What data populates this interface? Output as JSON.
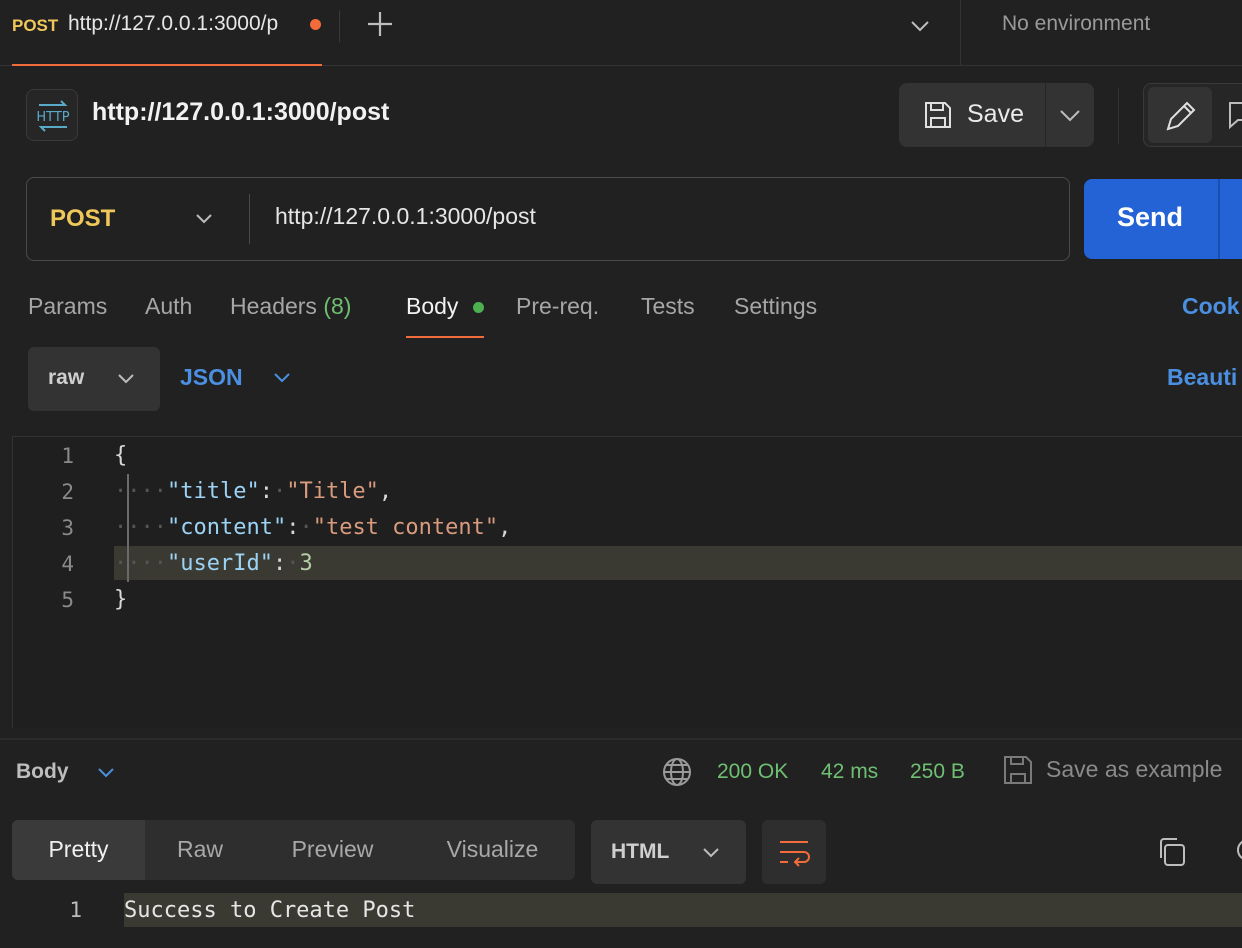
{
  "tabbar": {
    "active_tab": {
      "method": "POST",
      "title": "http://127.0.0.1:3000/p"
    },
    "environment": "No environment"
  },
  "request": {
    "name": "http://127.0.0.1:3000/post",
    "save_label": "Save",
    "method": "POST",
    "url": "http://127.0.0.1:3000/post",
    "send_label": "Send"
  },
  "request_tabs": {
    "params": "Params",
    "auth": "Auth",
    "headers": "Headers",
    "headers_count": "(8)",
    "body": "Body",
    "prereq": "Pre-req.",
    "tests": "Tests",
    "settings": "Settings",
    "cookies": "Cook"
  },
  "body_options": {
    "mode": "raw",
    "language": "JSON",
    "beautify": "Beauti"
  },
  "editor": {
    "lines": [
      {
        "num": "1",
        "text": "{"
      },
      {
        "num": "2",
        "key": "\"title\"",
        "value": "\"Title\""
      },
      {
        "num": "3",
        "key": "\"content\"",
        "value": "\"test content\""
      },
      {
        "num": "4",
        "key": "\"userId\"",
        "value": "3"
      },
      {
        "num": "5",
        "text": "}"
      }
    ]
  },
  "response": {
    "title": "Body",
    "status": "200 OK",
    "time": "42 ms",
    "size": "250 B",
    "save_example": "Save as example",
    "views": {
      "pretty": "Pretty",
      "raw": "Raw",
      "preview": "Preview",
      "visualize": "Visualize"
    },
    "format": "HTML",
    "lines": [
      {
        "num": "1",
        "text": "Success to Create Post"
      }
    ]
  },
  "colors": {
    "accent_orange": "#f26b3a",
    "method_yellow": "#f0c85a",
    "send_blue": "#2463d5",
    "link_blue": "#4a8fe0",
    "status_green": "#6fbf73"
  },
  "icons": {
    "new_tab": "plus-icon",
    "request_type": "http-icon",
    "save": "floppy-disk-icon",
    "edit": "pencil-icon",
    "response_network": "globe-icon",
    "wrap": "wrap-lines-icon",
    "copy": "copy-icon"
  }
}
